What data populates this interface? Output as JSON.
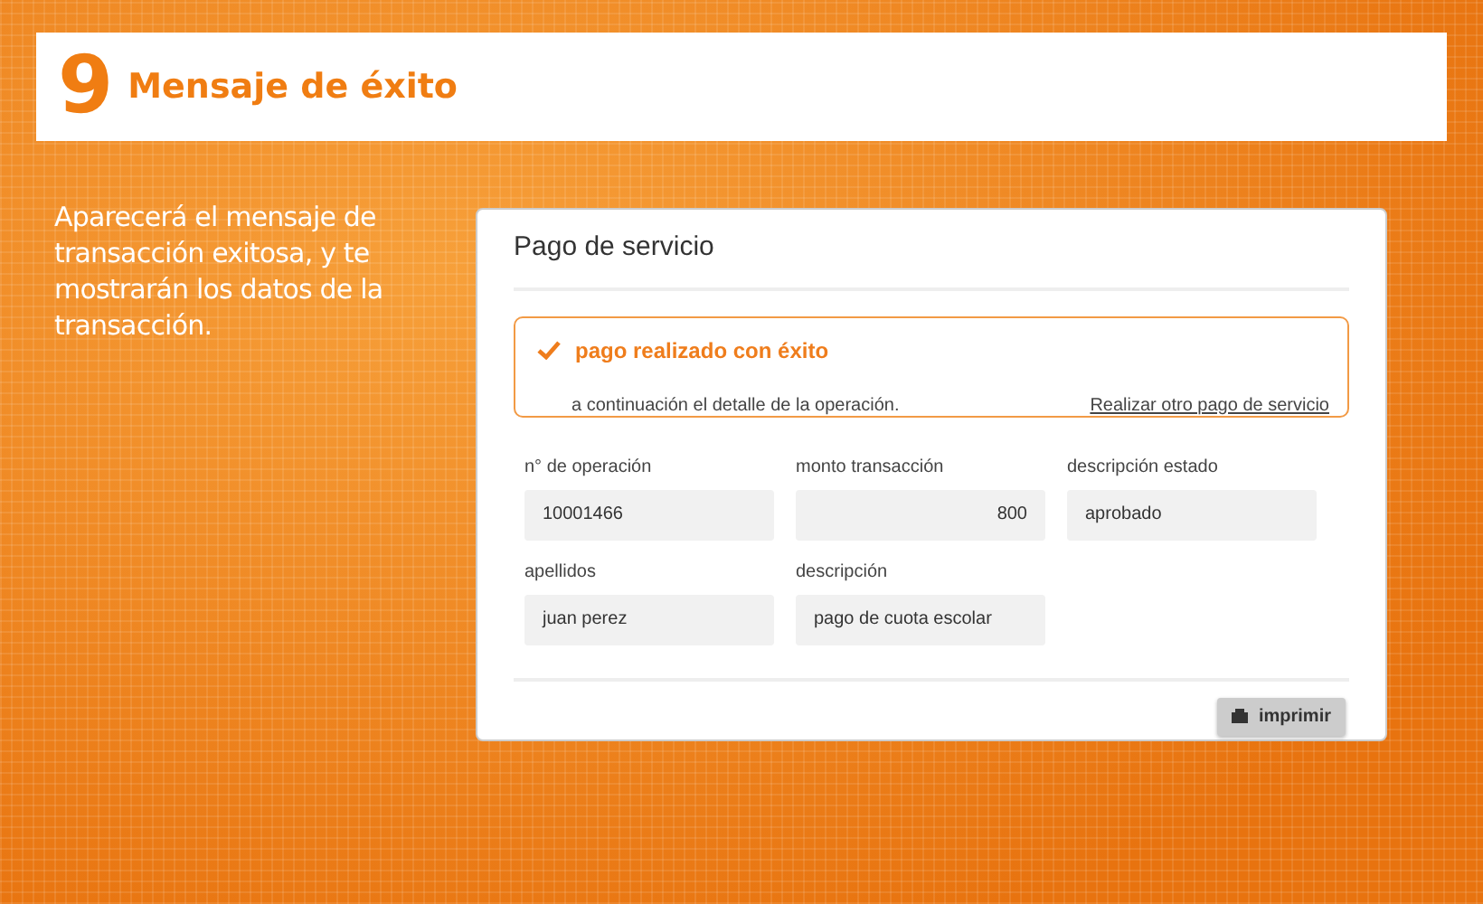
{
  "header": {
    "number": "9",
    "title": "Mensaje de éxito"
  },
  "intro": "Aparecerá el mensaje de transacción exitosa, y te mostrarán los datos de la transacción.",
  "panel": {
    "title": "Pago de servicio",
    "alert": {
      "title": "pago realizado con éxito",
      "text": "a continuación el detalle de la operación.",
      "link": "Realizar otro pago de servicio"
    },
    "fields": [
      {
        "label": "n° de operación",
        "value": "10001466",
        "kind": "text"
      },
      {
        "label": "monto transacción",
        "value": "800",
        "kind": "amount"
      },
      {
        "label": "descripción estado",
        "value": "aprobado",
        "kind": "text"
      },
      {
        "label": "apellidos",
        "value": "juan perez",
        "kind": "text"
      },
      {
        "label": "descripción",
        "value": "pago de cuota escolar",
        "kind": "text"
      }
    ],
    "button": "imprimir"
  }
}
